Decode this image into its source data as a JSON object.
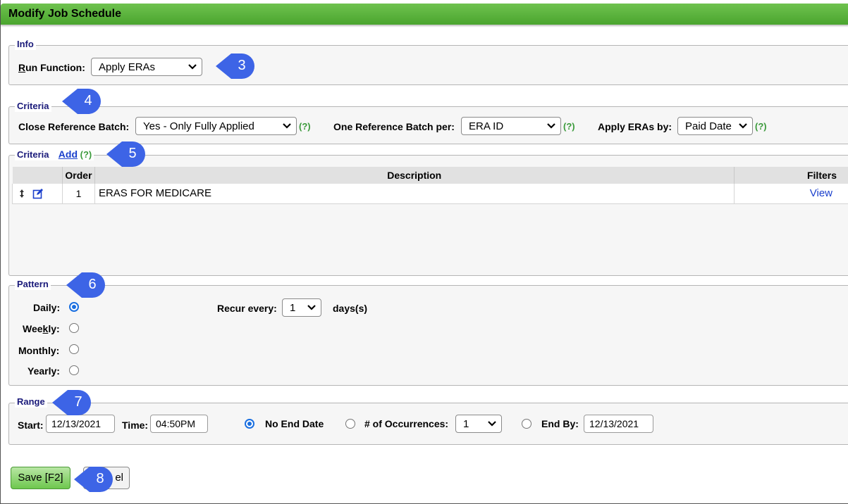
{
  "title": "Modify Job Schedule",
  "info": {
    "legend": "Info",
    "run_function_label_u": "R",
    "run_function_label_rest": "un Function:",
    "run_function_value": "Apply ERAs"
  },
  "criteria1": {
    "legend": "Criteria",
    "close_ref_label": "Close Reference Batch:",
    "close_ref_value": "Yes - Only Fully Applied",
    "one_ref_label": "One Reference Batch per:",
    "one_ref_value": "ERA ID",
    "apply_by_label": "Apply ERAs by:",
    "apply_by_value": "Paid Date",
    "help": "(?)"
  },
  "criteria2": {
    "legend": "Criteria",
    "add_link": "Add",
    "help": "(?)",
    "columns": [
      "Order",
      "Description",
      "Filters"
    ],
    "rows": [
      {
        "order": "1",
        "description": "ERAS FOR MEDICARE",
        "filters": "View"
      }
    ]
  },
  "pattern": {
    "legend": "Pattern",
    "daily": "Daily:",
    "weekly_pre": "Wee",
    "weekly_u": "k",
    "weekly_post": "ly:",
    "monthly": "Monthly:",
    "yearly": "Yearly:",
    "recur_label": "Recur every:",
    "recur_value": "1",
    "recur_unit": "days(s)"
  },
  "range": {
    "legend": "Range",
    "start_label": "Start:",
    "start_value": "12/13/2021",
    "time_label": "Time:",
    "time_value": "04:50PM",
    "no_end": "No End Date",
    "occurrences_label": "# of Occurrences:",
    "occurrences_value": "1",
    "end_by_label": "End By:",
    "end_by_value": "12/13/2021"
  },
  "buttons": {
    "save": "Save [F2]",
    "cancel_visible": "el"
  },
  "callouts": [
    "3",
    "4",
    "5",
    "6",
    "7",
    "8"
  ],
  "colors": {
    "title_green": "#5bb43d",
    "callout_blue": "#3d64e6",
    "legend_navy": "#1a1a7a",
    "help_green": "#3a9a3a",
    "link_blue": "#1a3fcc"
  }
}
